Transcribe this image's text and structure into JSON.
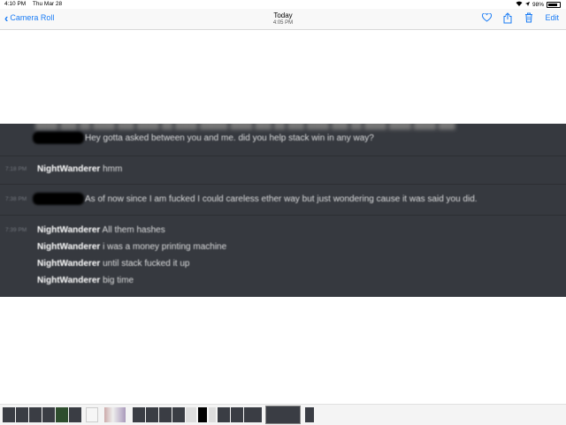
{
  "status_bar": {
    "time": "4:10 PM",
    "date": "Thu Mar 28",
    "battery": "98%"
  },
  "nav": {
    "back_label": "Camera Roll",
    "title": "Today",
    "subtitle": "4:05 PM",
    "edit_label": "Edit",
    "icons": [
      "heart-icon",
      "share-icon",
      "trash-icon"
    ]
  },
  "screenshot": {
    "messages": [
      {
        "time": "",
        "user": "",
        "text": "Hey gotta asked between you and me. did you help stack win in any way?",
        "redacted_user": true
      },
      {
        "time": "7:18 PM",
        "user": "NightWanderer",
        "text": "hmm",
        "redacted_user": false
      },
      {
        "time": "7:38 PM",
        "user": "",
        "text": "As of now since I am fucked I could careless ether way but just wondering cause it was said you did.",
        "redacted_user": true
      },
      {
        "time": "7:39 PM",
        "user": "NightWanderer",
        "text": "All them hashes",
        "redacted_user": false
      },
      {
        "time": "",
        "user": "NightWanderer",
        "text": "i was a money printing machine",
        "redacted_user": false
      },
      {
        "time": "",
        "user": "NightWanderer",
        "text": "until stack fucked it up",
        "redacted_user": false
      },
      {
        "time": "",
        "user": "NightWanderer",
        "text": "big time",
        "redacted_user": false
      }
    ]
  },
  "colors": {
    "accent": "#1a7cf5",
    "chat_background": "#36393f",
    "username": "#ffffff",
    "message_text": "#dcddde",
    "timestamp": "#72767d"
  }
}
